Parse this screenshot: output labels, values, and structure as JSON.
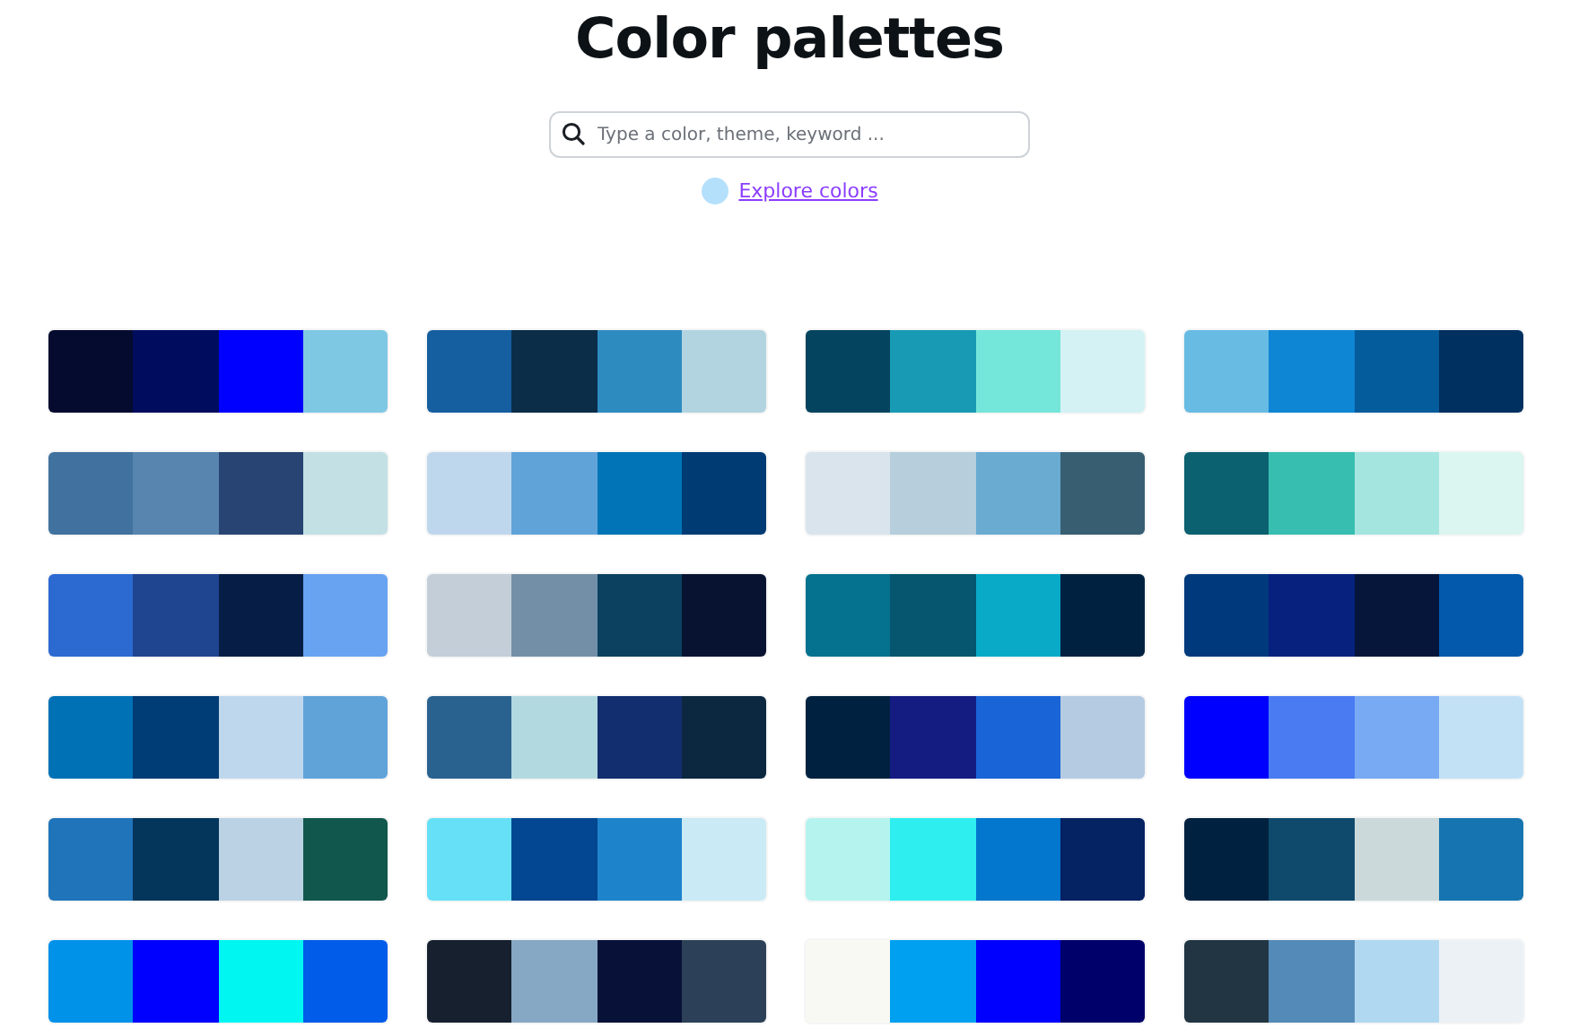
{
  "title": "Color palettes",
  "search": {
    "placeholder": "Type a color, theme, keyword ..."
  },
  "explore_link": {
    "label": "Explore colors",
    "color": "#b5e0fb"
  },
  "palettes": [
    {
      "swatches": [
        {
          "color": "#040b2f"
        },
        {
          "color": "#000d5e"
        },
        {
          "color": "#0000ff"
        },
        {
          "color": "#7fc8e3"
        }
      ]
    },
    {
      "swatches": [
        {
          "color": "#155ea0"
        },
        {
          "color": "#0b2d48"
        },
        {
          "color": "#2e8bc0"
        },
        {
          "color": "#b1d4e0"
        }
      ]
    },
    {
      "swatches": [
        {
          "color": "#05445e"
        },
        {
          "color": "#189ab4"
        },
        {
          "color": "#75e6da"
        },
        {
          "color": "#d4f1f4"
        }
      ]
    },
    {
      "swatches": [
        {
          "color": "#68bbe3"
        },
        {
          "color": "#0e86d4"
        },
        {
          "color": "#055c9d"
        },
        {
          "color": "#003060"
        }
      ]
    },
    {
      "swatches": [
        {
          "color": "#41729f"
        },
        {
          "color": "#5885af"
        },
        {
          "color": "#274472"
        },
        {
          "color": "#c3e0e5"
        }
      ]
    },
    {
      "swatches": [
        {
          "color": "#bfd7ed"
        },
        {
          "color": "#60a3d9"
        },
        {
          "color": "#0074b7"
        },
        {
          "color": "#003b73"
        }
      ]
    },
    {
      "swatches": [
        {
          "color": "#d9e4ec"
        },
        {
          "color": "#b7cfdc"
        },
        {
          "color": "#6aabd2"
        },
        {
          "color": "#385e72"
        }
      ]
    },
    {
      "swatches": [
        {
          "color": "#0c6170"
        },
        {
          "color": "#37beb0"
        },
        {
          "color": "#a4e5e0"
        },
        {
          "color": "#dbf5f0"
        }
      ]
    },
    {
      "swatches": [
        {
          "color": "#2c69d1"
        },
        {
          "color": "#1f4591"
        },
        {
          "color": "#061e45"
        },
        {
          "color": "#68a3f2"
        }
      ]
    },
    {
      "swatches": [
        {
          "color": "#c3ced9"
        },
        {
          "color": "#738fa7"
        },
        {
          "color": "#0c4160"
        },
        {
          "color": "#071330"
        }
      ]
    },
    {
      "swatches": [
        {
          "color": "#05728f"
        },
        {
          "color": "#05566e"
        },
        {
          "color": "#08aac7"
        },
        {
          "color": "#002240"
        }
      ]
    },
    {
      "swatches": [
        {
          "color": "#003a7d"
        },
        {
          "color": "#06227e"
        },
        {
          "color": "#05163a"
        },
        {
          "color": "#0359ac"
        }
      ]
    },
    {
      "swatches": [
        {
          "color": "#0071b5"
        },
        {
          "color": "#003c75"
        },
        {
          "color": "#bfd7ed"
        },
        {
          "color": "#60a3d9"
        }
      ]
    },
    {
      "swatches": [
        {
          "color": "#2a628f"
        },
        {
          "color": "#b3d9e0"
        },
        {
          "color": "#132e6e"
        },
        {
          "color": "#0c2840"
        }
      ]
    },
    {
      "swatches": [
        {
          "color": "#002240"
        },
        {
          "color": "#141c82"
        },
        {
          "color": "#1964d6"
        },
        {
          "color": "#b5cbe2"
        }
      ]
    },
    {
      "swatches": [
        {
          "color": "#0000ff"
        },
        {
          "color": "#4a7bf2"
        },
        {
          "color": "#78a9f3"
        },
        {
          "color": "#c3e1f5"
        }
      ]
    },
    {
      "swatches": [
        {
          "color": "#1f74ba"
        },
        {
          "color": "#04355b"
        },
        {
          "color": "#bad2e4"
        },
        {
          "color": "#11574e"
        }
      ]
    },
    {
      "swatches": [
        {
          "color": "#66e0f6"
        },
        {
          "color": "#034691"
        },
        {
          "color": "#1d84cc"
        },
        {
          "color": "#caeaf5"
        }
      ]
    },
    {
      "swatches": [
        {
          "color": "#b5f3ef"
        },
        {
          "color": "#2eeeef"
        },
        {
          "color": "#0377cd"
        },
        {
          "color": "#052262"
        }
      ]
    },
    {
      "swatches": [
        {
          "color": "#002240"
        },
        {
          "color": "#0f4a6d"
        },
        {
          "color": "#cbd9db"
        },
        {
          "color": "#1675b0"
        }
      ]
    },
    {
      "swatches": [
        {
          "color": "#0091e9"
        },
        {
          "color": "#0000ff"
        },
        {
          "color": "#00f7f1"
        },
        {
          "color": "#005ce9"
        }
      ]
    },
    {
      "swatches": [
        {
          "color": "#16202f"
        },
        {
          "color": "#87a8c4"
        },
        {
          "color": "#081238"
        },
        {
          "color": "#2c4157"
        }
      ]
    },
    {
      "swatches": [
        {
          "color": "#f9f9f3"
        },
        {
          "color": "#00a0f0"
        },
        {
          "color": "#0000ff"
        },
        {
          "color": "#00006a"
        }
      ]
    },
    {
      "swatches": [
        {
          "color": "#213542"
        },
        {
          "color": "#548ab7"
        },
        {
          "color": "#b0d8f1"
        },
        {
          "color": "#ebf1f5"
        }
      ]
    }
  ]
}
